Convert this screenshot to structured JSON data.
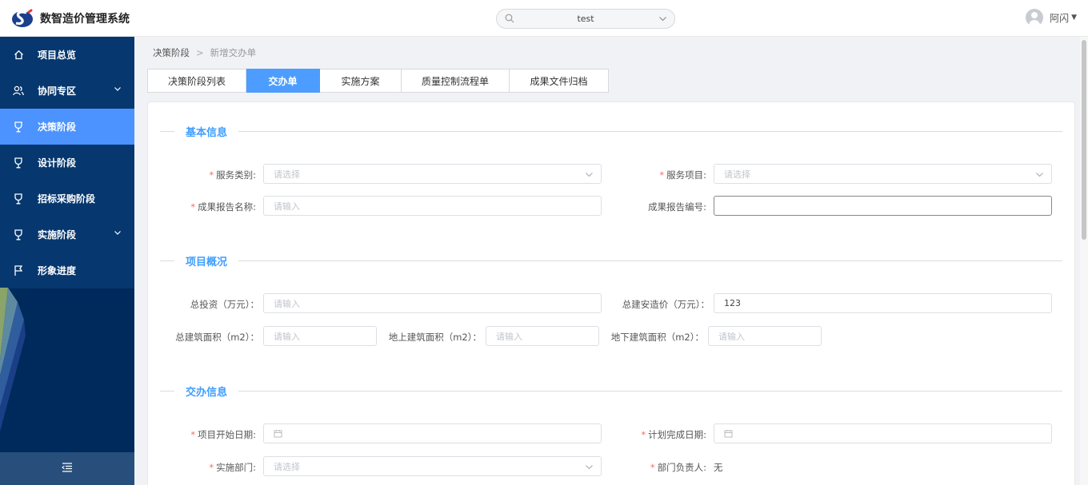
{
  "app": {
    "title": "数智造价管理系统"
  },
  "header": {
    "project_select_value": "test",
    "user_name": "阿闪"
  },
  "sidebar": {
    "items": [
      {
        "label": "项目总览",
        "icon": "home-icon",
        "active": false,
        "expandable": false
      },
      {
        "label": "协同专区",
        "icon": "users-icon",
        "active": false,
        "expandable": true
      },
      {
        "label": "决策阶段",
        "icon": "trophy-icon",
        "active": true,
        "expandable": false
      },
      {
        "label": "设计阶段",
        "icon": "trophy-icon",
        "active": false,
        "expandable": false
      },
      {
        "label": "招标采购阶段",
        "icon": "trophy-icon",
        "active": false,
        "expandable": false
      },
      {
        "label": "实施阶段",
        "icon": "trophy-icon",
        "active": false,
        "expandable": true
      },
      {
        "label": "形象进度",
        "icon": "flag-icon",
        "active": false,
        "expandable": false
      }
    ],
    "collapse_icon": "menu-fold-icon"
  },
  "breadcrumb": {
    "parent": "决策阶段",
    "current": "新增交办单"
  },
  "tabs": [
    {
      "label": "决策阶段列表",
      "active": false
    },
    {
      "label": "交办单",
      "active": true
    },
    {
      "label": "实施方案",
      "active": false
    },
    {
      "label": "质量控制流程单",
      "active": false
    },
    {
      "label": "成果文件归档",
      "active": false
    }
  ],
  "sections": {
    "basic": "基本信息",
    "overview": "项目概况",
    "handover": "交办信息"
  },
  "form": {
    "service_category": {
      "label": "服务类别:",
      "placeholder": "请选择",
      "required": true
    },
    "service_item": {
      "label": "服务项目:",
      "placeholder": "请选择",
      "required": true
    },
    "report_name": {
      "label": "成果报告名称:",
      "placeholder": "请输入",
      "required": true
    },
    "report_number": {
      "label": "成果报告编号:",
      "value": ""
    },
    "total_investment": {
      "label": "总投资（万元）：",
      "placeholder": "请输入"
    },
    "total_install_price": {
      "label": "总建安造价（万元）：",
      "value": "123"
    },
    "total_floor_area": {
      "label": "总建筑面积（m2）：",
      "placeholder": "请输入"
    },
    "above_ground_area": {
      "label": "地上建筑面积（m2）：",
      "placeholder": "请输入"
    },
    "underground_area": {
      "label": "地下建筑面积（m2）：",
      "placeholder": "请输入"
    },
    "start_date": {
      "label": "项目开始日期:",
      "required": true
    },
    "planned_finish_date": {
      "label": "计划完成日期:",
      "required": true
    },
    "department": {
      "label": "实施部门:",
      "placeholder": "请选择",
      "required": true
    },
    "department_head": {
      "label": "部门负责人:",
      "value": "无",
      "required": true
    }
  },
  "colors": {
    "sidebar_bg": "#06376e",
    "active": "#4c93ff",
    "accent": "#409eff",
    "required": "#f56c6c"
  }
}
